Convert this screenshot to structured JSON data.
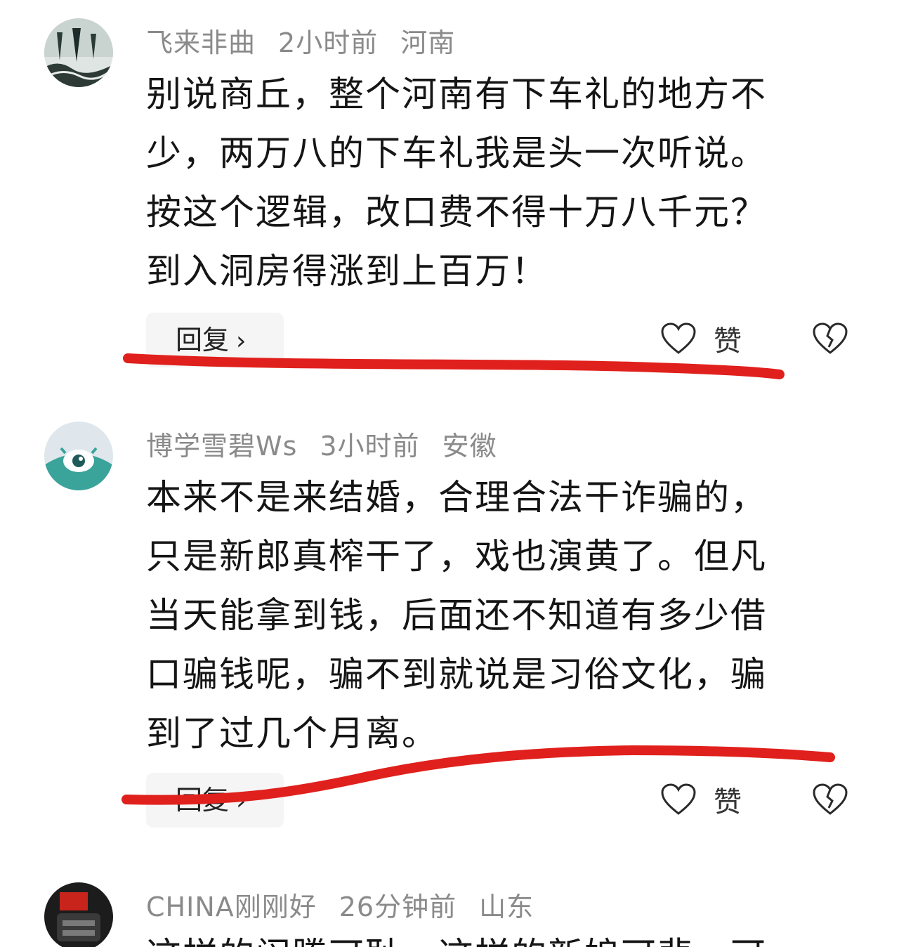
{
  "comments": [
    {
      "username": "飞来非曲",
      "time": "2小时前",
      "location": "河南",
      "lines": [
        "别说商丘，整个河南有下车礼的地方不",
        "少，两万八的下车礼我是头一次听说。",
        "按这个逻辑，改口费不得十万八千元？",
        "到入洞房得涨到上百万！"
      ],
      "reply_label": "回复",
      "like_label": "赞"
    },
    {
      "username": "博学雪碧Ws",
      "time": "3小时前",
      "location": "安徽",
      "lines": [
        "本来不是来结婚，合理合法干诈骗的，",
        "只是新郎真榨干了，戏也演黄了。但凡",
        "当天能拿到钱，后面还不知道有多少借",
        "口骗钱呢，骗不到就说是习俗文化，骗",
        "到了过几个月离。"
      ],
      "reply_label": "回复",
      "like_label": "赞"
    },
    {
      "username": "CHINA刚刚好",
      "time": "26分钟前",
      "location": "山东",
      "partial_line": "这样的闹腾可耻，这样的新娘可悲，可"
    }
  ],
  "colors": {
    "meta_gray": "#8a8a8a",
    "annotation_red": "#e0201c",
    "avatar2_teal": "#3aa39a"
  }
}
